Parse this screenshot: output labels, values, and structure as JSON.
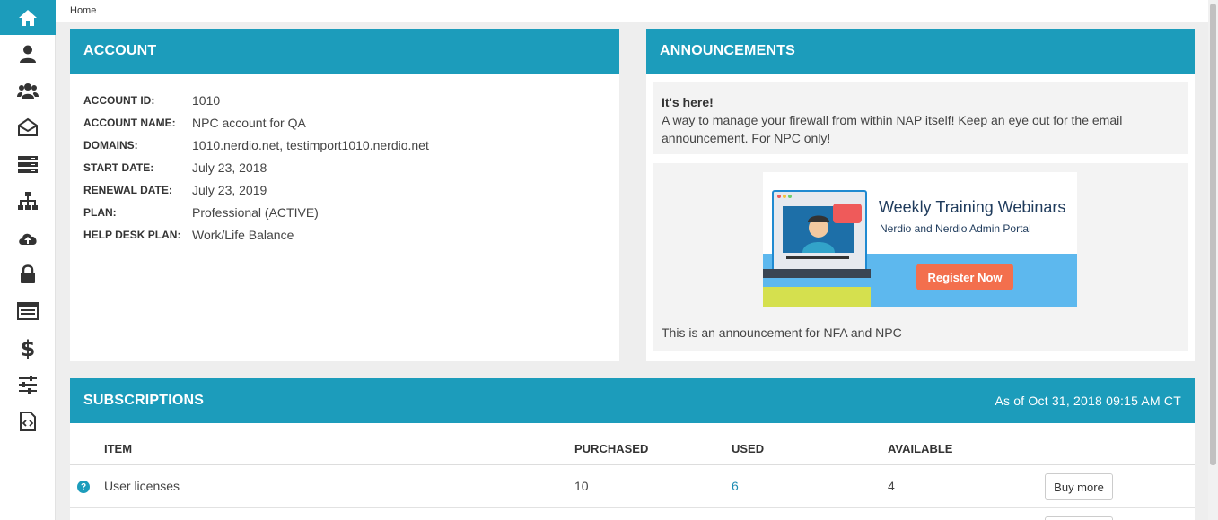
{
  "breadcrumb": {
    "home": "Home"
  },
  "sidebar": {
    "items": [
      {
        "icon": "home-icon"
      },
      {
        "icon": "user-icon"
      },
      {
        "icon": "users-icon"
      },
      {
        "icon": "envelope-open-icon"
      },
      {
        "icon": "server-icon"
      },
      {
        "icon": "sitemap-icon"
      },
      {
        "icon": "cloud-upload-icon"
      },
      {
        "icon": "lock-icon"
      },
      {
        "icon": "list-alt-icon"
      },
      {
        "icon": "dollar-icon"
      },
      {
        "icon": "sliders-icon"
      },
      {
        "icon": "code-file-icon"
      }
    ]
  },
  "account": {
    "title": "ACCOUNT",
    "fields": [
      {
        "label": "ACCOUNT ID:",
        "value": "1010"
      },
      {
        "label": "ACCOUNT NAME:",
        "value": "NPC account for QA"
      },
      {
        "label": "DOMAINS:",
        "value": "1010.nerdio.net, testimport1010.nerdio.net"
      },
      {
        "label": "START DATE:",
        "value": "July 23, 2018"
      },
      {
        "label": "RENEWAL DATE:",
        "value": "July 23, 2019"
      },
      {
        "label": "PLAN:",
        "value": "Professional (ACTIVE)"
      },
      {
        "label": "HELP DESK PLAN:",
        "value": "Work/Life Balance"
      }
    ]
  },
  "announcements": {
    "title": "ANNOUNCEMENTS",
    "items": [
      {
        "title": "It's here!",
        "body": "A way to manage your firewall from within NAP itself! Keep an eye out for the email announcement. For NPC only!"
      }
    ],
    "banner": {
      "title": "Weekly Training Webinars",
      "subtitle": "Nerdio and Nerdio Admin Portal",
      "button": "Register Now"
    },
    "caption": "This is an announcement for NFA and NPC"
  },
  "subscriptions": {
    "title": "SUBSCRIPTIONS",
    "as_of": "As of Oct 31, 2018 09:15 AM CT",
    "columns": {
      "item": "ITEM",
      "purchased": "PURCHASED",
      "used": "USED",
      "available": "AVAILABLE"
    },
    "rows": [
      {
        "item": "User licenses",
        "purchased": "10",
        "used": "6",
        "available": "4",
        "action": "Buy more",
        "help": "?"
      }
    ]
  },
  "colors": {
    "accent": "#1c9cbb",
    "link": "#1c8bb2"
  }
}
